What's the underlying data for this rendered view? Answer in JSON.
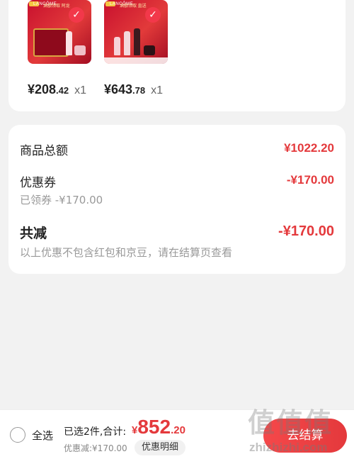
{
  "products": [
    {
      "price_int": "¥208",
      "price_dec": ".42",
      "qty": "x1",
      "selected": true,
      "brand": "LANCÔME",
      "promo": "满额领取 阿龙"
    },
    {
      "price_int": "¥643",
      "price_dec": ".78",
      "qty": "x1",
      "selected": true,
      "brand": "LANCÔME",
      "promo": "满额领取 直送"
    }
  ],
  "summary": {
    "goods_total_label": "商品总额",
    "goods_total_value": "¥1022.20",
    "coupon_label": "优惠券",
    "coupon_value": "-¥170.00",
    "coupon_note": "已领券 -¥170.00",
    "total_off_label": "共减",
    "total_off_value": "-¥170.00",
    "disclaimer": "以上优惠不包含红包和京豆，请在结算页查看"
  },
  "bottom_bar": {
    "select_all": "全选",
    "selected_count": "已选2件,合计:",
    "total_currency": "¥",
    "total_int": "852",
    "total_dec": ".20",
    "discount_note": "优惠减:¥170.00",
    "detail_button": "优惠明细",
    "checkout_button": "去结算"
  },
  "watermark": {
    "logo": "值值值",
    "url": "zhizhizhi.com"
  },
  "colors": {
    "accent": "#e4393c",
    "background": "#f2f2f2"
  },
  "icons": {
    "check": "check-icon",
    "radio": "radio-unchecked-icon"
  }
}
